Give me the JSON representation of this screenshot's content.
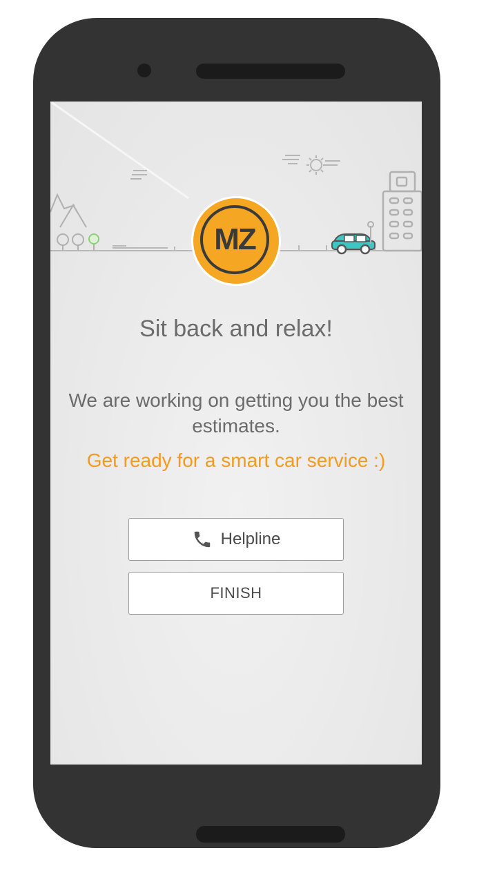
{
  "logo": {
    "text": "MZ",
    "color": "#f5a623"
  },
  "headline": "Sit back and relax!",
  "description": "We are working on getting you the best estimates.",
  "tagline": "Get ready for a smart car service :)",
  "buttons": {
    "helpline_label": "Helpline",
    "helpline_icon": "phone-icon",
    "finish_label": "FINISH"
  },
  "colors": {
    "accent": "#f39a1f",
    "text": "#6b6b6b",
    "car": "#3ec7c2"
  }
}
